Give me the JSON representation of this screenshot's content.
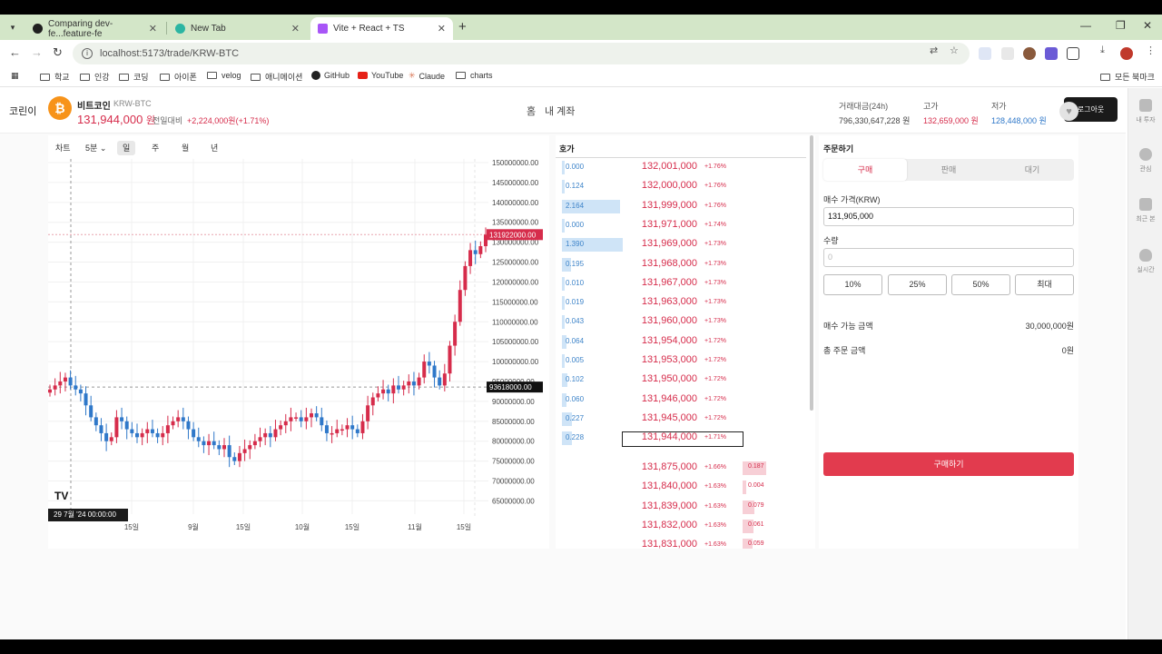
{
  "browser": {
    "tabs": [
      {
        "title": "Comparing dev-fe...feature-fe",
        "favicon_color": "#1f1f1f"
      },
      {
        "title": "New Tab",
        "favicon_color": "#2bb5a2"
      },
      {
        "title": "Vite + React + TS",
        "favicon_color": "#a855f7"
      }
    ],
    "url": "localhost:5173/trade/KRW-BTC",
    "bookmarks": [
      "학교",
      "인강",
      "코딩",
      "아이폰",
      "velog",
      "애니메이션",
      "GitHub",
      "YouTube",
      "Claude",
      "charts"
    ],
    "all_bookmarks": "모든 북마크"
  },
  "app": {
    "brand": "코린이",
    "nav_home": "홈",
    "nav_account": "내 계좌",
    "logout": "로그아웃"
  },
  "sidebar": {
    "items": [
      "내 투자",
      "관심",
      "최근 본",
      "실시간"
    ]
  },
  "coin": {
    "name": "비트코인",
    "code": "KRW-BTC",
    "price": "131,944,000",
    "unit": "원",
    "change_label": "전일대비",
    "change_value": "+2,224,000원(+1.71%)",
    "volume_label": "거래대금(24h)",
    "volume_value": "796,330,647,228 원",
    "high_label": "고가",
    "high_value": "132,659,000 원",
    "low_label": "저가",
    "low_value": "128,448,000 원"
  },
  "chart": {
    "tab_chart": "차트",
    "interval": "5분",
    "periods": [
      "일",
      "주",
      "월",
      "년"
    ],
    "selected_period": "일",
    "time_tag": "29 7월 '24    00:00:00",
    "tv_logo": "TV",
    "price_tag_high": "131922000.00",
    "price_tag_cross": "93618000.00",
    "colors": {
      "up": "#d62c4b",
      "down": "#2f78c9"
    }
  },
  "chart_data": {
    "type": "candlestick",
    "y_ticks": [
      "150000000.00",
      "145000000.00",
      "140000000.00",
      "135000000.00",
      "130000000.00",
      "125000000.00",
      "120000000.00",
      "115000000.00",
      "110000000.00",
      "105000000.00",
      "100000000.00",
      "95000000.00",
      "90000000.00",
      "85000000.00",
      "80000000.00",
      "75000000.00",
      "70000000.00",
      "65000000.00"
    ],
    "x_ticks": [
      "15일",
      "9월",
      "15일",
      "10월",
      "15일",
      "11월",
      "15일"
    ],
    "ylim": [
      63000000,
      150000000
    ],
    "closes": [
      93,
      94,
      95,
      96,
      94,
      93,
      92,
      89,
      86,
      84,
      82,
      80,
      81,
      86,
      85,
      83,
      82,
      81,
      82,
      83,
      82,
      81,
      82,
      84,
      85,
      86,
      85,
      83,
      81,
      80,
      79,
      80,
      79,
      78,
      79,
      76,
      75,
      77,
      78,
      79,
      80,
      81,
      82,
      81,
      83,
      84,
      85,
      86,
      86,
      85,
      86,
      87,
      86,
      84,
      82,
      82,
      83,
      83,
      84,
      83,
      82,
      85,
      89,
      91,
      92,
      93,
      92,
      94,
      93,
      94,
      95,
      94,
      96,
      100,
      99,
      96,
      94,
      97,
      104,
      110,
      118,
      124,
      128,
      127,
      129,
      131.9
    ]
  },
  "orderbook": {
    "title": "호가",
    "asks": [
      {
        "qty": "0.000",
        "price": "132,001,000",
        "pct": "+1.76%",
        "bar": 0
      },
      {
        "qty": "0.124",
        "price": "132,000,000",
        "pct": "+1.76%",
        "bar": 0.02
      },
      {
        "qty": "2.164",
        "price": "131,999,000",
        "pct": "+1.76%",
        "bar": 0.4
      },
      {
        "qty": "0.000",
        "price": "131,971,000",
        "pct": "+1.74%",
        "bar": 0
      },
      {
        "qty": "1.390",
        "price": "131,969,000",
        "pct": "+1.73%",
        "bar": 0.42
      },
      {
        "qty": "0.195",
        "price": "131,968,000",
        "pct": "+1.73%",
        "bar": 0.06
      },
      {
        "qty": "0.010",
        "price": "131,967,000",
        "pct": "+1.73%",
        "bar": 0.01
      },
      {
        "qty": "0.019",
        "price": "131,963,000",
        "pct": "+1.73%",
        "bar": 0.01
      },
      {
        "qty": "0.043",
        "price": "131,960,000",
        "pct": "+1.73%",
        "bar": 0.02
      },
      {
        "qty": "0.064",
        "price": "131,954,000",
        "pct": "+1.72%",
        "bar": 0.03
      },
      {
        "qty": "0.005",
        "price": "131,953,000",
        "pct": "+1.72%",
        "bar": 0.01
      },
      {
        "qty": "0.102",
        "price": "131,950,000",
        "pct": "+1.72%",
        "bar": 0.04
      },
      {
        "qty": "0.060",
        "price": "131,946,000",
        "pct": "+1.72%",
        "bar": 0.03
      },
      {
        "qty": "0.227",
        "price": "131,945,000",
        "pct": "+1.72%",
        "bar": 0.07
      },
      {
        "qty": "0.228",
        "price": "131,944,000",
        "pct": "+1.71%",
        "bar": 0.07
      }
    ],
    "bids": [
      {
        "price": "131,875,000",
        "pct": "+1.66%",
        "qty": "0.187",
        "bar": 0.4
      },
      {
        "price": "131,840,000",
        "pct": "+1.63%",
        "qty": "0.004",
        "bar": 0.05
      },
      {
        "price": "131,839,000",
        "pct": "+1.63%",
        "qty": "0.079",
        "bar": 0.2
      },
      {
        "price": "131,832,000",
        "pct": "+1.63%",
        "qty": "0.061",
        "bar": 0.18
      },
      {
        "price": "131,831,000",
        "pct": "+1.63%",
        "qty": "0.059",
        "bar": 0.17
      }
    ]
  },
  "order": {
    "title": "주문하기",
    "tabs": [
      "구매",
      "판매",
      "대기"
    ],
    "selected_tab": "구매",
    "price_label": "매수 가격(KRW)",
    "price_value": "131,905,000",
    "qty_label": "수량",
    "qty_placeholder": "0",
    "pct_buttons": [
      "10%",
      "25%",
      "50%",
      "최대"
    ],
    "available_label": "매수 가능 금액",
    "available_value": "30,000,000원",
    "total_label": "총 주문 금액",
    "total_value": "0원",
    "buy_button": "구매하기"
  }
}
